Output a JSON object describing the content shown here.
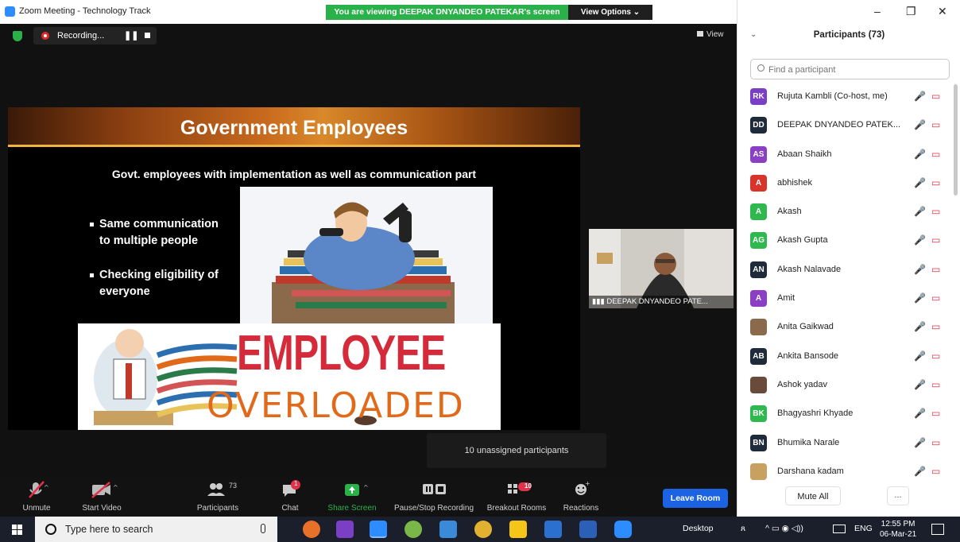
{
  "window": {
    "title": "Zoom Meeting - Technology Track",
    "screen_banner": "You are viewing DEEPAK DNYANDEO PATEKAR's screen",
    "view_options": "View Options ⌄",
    "minimize": "–",
    "maximize": "❐",
    "close": "✕"
  },
  "meeting": {
    "recording_label": "Recording...",
    "view_label": "View",
    "video_name": "DEEPAK DNYANDEO PATE...",
    "unassigned_tooltip": "10 unassigned participants"
  },
  "slide": {
    "title": "Government Employees",
    "subtitle": "Govt. employees with implementation as well as communication part",
    "bullets": [
      "Same communication to multiple people",
      "Checking eligibility of everyone"
    ],
    "banner_word1": "EMPLOYEE",
    "banner_word2": "OVERLOADED"
  },
  "toolbar": {
    "unmute": "Unmute",
    "start_video": "Start Video",
    "participants": "Participants",
    "participants_count": "73",
    "chat": "Chat",
    "chat_badge": "1",
    "share_screen": "Share Screen",
    "pause_stop_recording": "Pause/Stop Recording",
    "breakout_rooms": "Breakout Rooms",
    "breakout_badge": "10",
    "reactions": "Reactions",
    "leave_room": "Leave Room"
  },
  "panel": {
    "title": "Participants (73)",
    "search_placeholder": "Find a participant",
    "mute_all": "Mute All",
    "more": "...",
    "participants": [
      {
        "initials": "RK",
        "color": "#7a3fc4",
        "name": "Rujuta Kambli (Co-host, me)"
      },
      {
        "initials": "DD",
        "color": "#1f2a3a",
        "name": "DEEPAK DNYANDEO PATEK..."
      },
      {
        "initials": "AS",
        "color": "#8a3fc4",
        "name": "Abaan Shaikh"
      },
      {
        "initials": "A",
        "color": "#d9342b",
        "name": "abhishek"
      },
      {
        "initials": "A",
        "color": "#2fb84e",
        "name": "Akash"
      },
      {
        "initials": "AG",
        "color": "#2fb84e",
        "name": "Akash Gupta"
      },
      {
        "initials": "AN",
        "color": "#1f2a3a",
        "name": "Akash Nalavade"
      },
      {
        "initials": "A",
        "color": "#8a3fc4",
        "name": "Amit"
      },
      {
        "initials": "",
        "color": "#8a6a4a",
        "name": "Anita Gaikwad"
      },
      {
        "initials": "AB",
        "color": "#1f2a3a",
        "name": "Ankita Bansode"
      },
      {
        "initials": "",
        "color": "#6a4a3a",
        "name": "Ashok yadav"
      },
      {
        "initials": "BK",
        "color": "#2fb84e",
        "name": "Bhagyashri Khyade"
      },
      {
        "initials": "BN",
        "color": "#1f2a3a",
        "name": "Bhumika Narale"
      },
      {
        "initials": "",
        "color": "#c8a060",
        "name": "Darshana kadam"
      }
    ]
  },
  "taskbar": {
    "search_text": "Type here to search",
    "desktop": "Desktop",
    "lang": "ENG",
    "time": "12:55 PM",
    "date": "06-Mar-21"
  }
}
